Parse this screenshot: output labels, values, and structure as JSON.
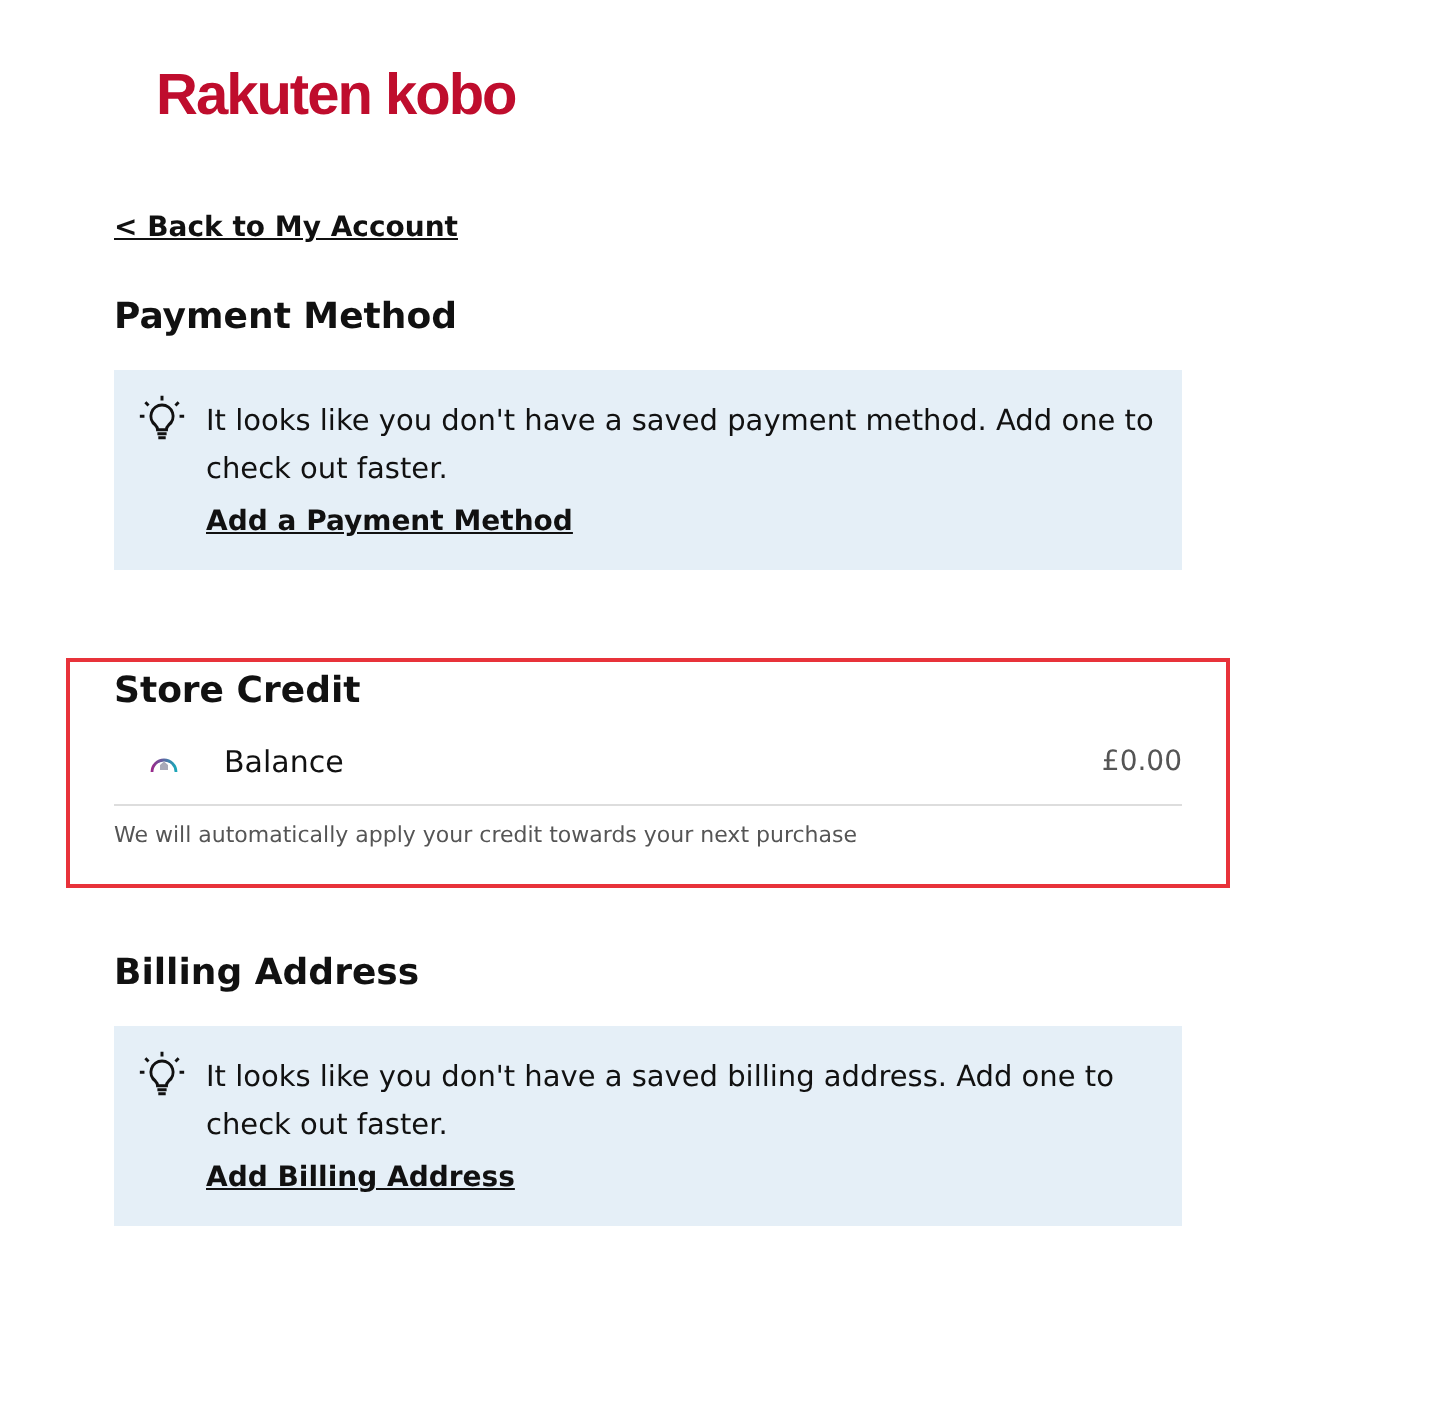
{
  "logo": {
    "text": "Rakuten kobo"
  },
  "back_link": "< Back to My Account",
  "sections": [
    {
      "kind": "notice",
      "title": "Payment Method",
      "message": "It looks like you don't have a saved payment method. Add one to check out faster.",
      "link": "Add a Payment Method"
    },
    {
      "kind": "credit",
      "title": "Store Credit",
      "highlighted": true,
      "label": "Balance",
      "amount": "£0.00",
      "note": "We will automatically apply your credit towards your next purchase"
    },
    {
      "kind": "notice",
      "title": "Billing Address",
      "message": "It looks like you don't have a saved billing address. Add one to check out faster.",
      "link": "Add Billing Address"
    }
  ]
}
